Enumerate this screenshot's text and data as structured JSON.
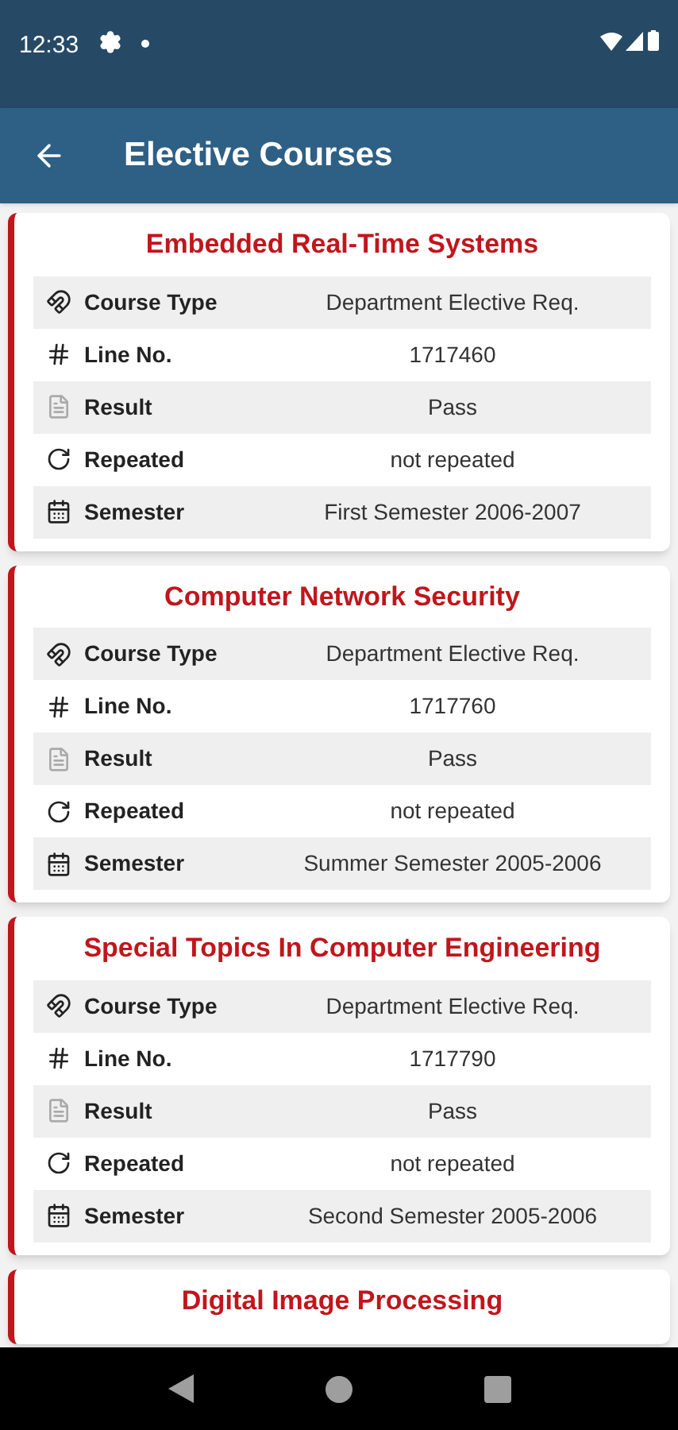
{
  "status_bar": {
    "time": "12:33"
  },
  "app_bar": {
    "title": "Elective Courses"
  },
  "courses": [
    {
      "title": "Embedded Real-Time Systems",
      "rows": [
        {
          "kind": "type",
          "label": "Course Type",
          "value": "Department Elective Req."
        },
        {
          "kind": "line",
          "label": "Line No.",
          "value": "1717460"
        },
        {
          "kind": "result",
          "label": "Result",
          "value": "Pass"
        },
        {
          "kind": "repeat",
          "label": "Repeated",
          "value": "not repeated"
        },
        {
          "kind": "semester",
          "label": "Semester",
          "value": "First Semester 2006-2007"
        }
      ]
    },
    {
      "title": "Computer Network Security",
      "rows": [
        {
          "kind": "type",
          "label": "Course Type",
          "value": "Department Elective Req."
        },
        {
          "kind": "line",
          "label": "Line No.",
          "value": "1717760"
        },
        {
          "kind": "result",
          "label": "Result",
          "value": "Pass"
        },
        {
          "kind": "repeat",
          "label": "Repeated",
          "value": "not repeated"
        },
        {
          "kind": "semester",
          "label": "Semester",
          "value": "Summer Semester 2005-2006"
        }
      ]
    },
    {
      "title": "Special Topics In Computer Engineering",
      "rows": [
        {
          "kind": "type",
          "label": "Course Type",
          "value": "Department Elective Req."
        },
        {
          "kind": "line",
          "label": "Line No.",
          "value": "1717790"
        },
        {
          "kind": "result",
          "label": "Result",
          "value": "Pass"
        },
        {
          "kind": "repeat",
          "label": "Repeated",
          "value": "not repeated"
        },
        {
          "kind": "semester",
          "label": "Semester",
          "value": "Second Semester 2005-2006"
        }
      ]
    },
    {
      "title": "Digital Image Processing"
    }
  ]
}
